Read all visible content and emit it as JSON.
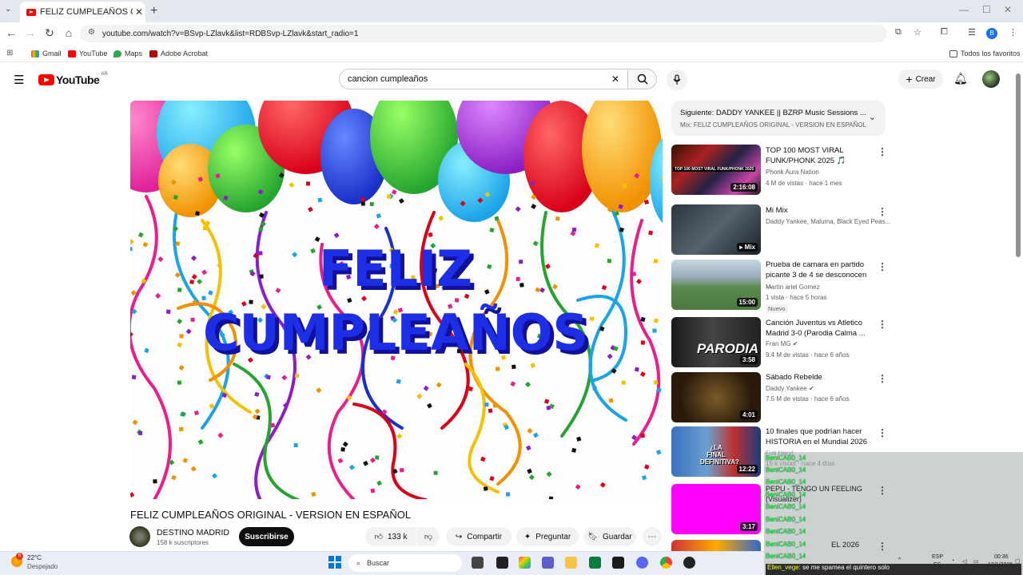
{
  "browser": {
    "tab_title": "FELIZ CUMPLEAÑOS ORIGINAL",
    "url": "youtube.com/watch?v=BSvp-LZlavk&list=RDBSvp-LZlavk&start_radio=1",
    "bookmarks": [
      "Gmail",
      "YouTube",
      "Maps",
      "Adobe Acrobat"
    ],
    "all_favorites": "Todos los favoritos",
    "profile_letter": "B"
  },
  "youtube": {
    "logo_text": "YouTube",
    "country": "AR",
    "search_value": "cancion cumpleaños",
    "create_label": "Crear"
  },
  "video": {
    "overlay_line1": "FELIZ",
    "overlay_line2": "CUMPLEAÑOS",
    "title": "FELIZ CUMPLEAÑOS ORIGINAL - VERSION EN ESPAÑOL",
    "channel": "DESTINO MADRID",
    "subscribers": "158 k suscriptores",
    "subscribe_label": "Suscribirse",
    "likes": "133 k",
    "share_label": "Compartir",
    "ask_label": "Preguntar",
    "save_label": "Guardar"
  },
  "up_next": {
    "line1": "Siguiente: DADDY YANKEE || BZRP Music Sessions ...",
    "line2": "Mix: FELIZ CUMPLEAÑOS ORIGINAL - VERSION EN ESPAÑOL"
  },
  "sidebar_videos": [
    {
      "title": "TOP 100 MOST VIRAL FUNK/PHONK 2025 🎵",
      "channel": "Phonk Aura Nation",
      "meta": "4 M de vistas · hace 1 mes",
      "duration": "2:16:08",
      "thumb_text": "TOP 100 MOST VIRAL FUNK/PHONK 2025"
    },
    {
      "title": "Mi Mix",
      "channel": "Daddy Yankee, Maluma, Black Eyed Peas...",
      "meta": "",
      "duration": "Mix"
    },
    {
      "title": "Prueba de camara en partido picante 3 de 4 se desconocen ...",
      "channel": "Martin ariel Gomez",
      "meta": "1 vista · hace 5 horas",
      "badge": "Nuevo",
      "duration": "15:00"
    },
    {
      "title": "Canción Juventus vs Atletico Madrid 3-0 (Parodia Calma ...",
      "channel": "Fran MG",
      "meta": "9.4 M de vistas · hace 6 años",
      "duration": "3:58",
      "thumb_text": "PARODIA"
    },
    {
      "title": "Sábado Rebelde",
      "channel": "Daddy Yankee",
      "meta": "7.5 M de vistas · hace 6 años",
      "duration": "4:01"
    },
    {
      "title": "10 finales que podrían hacer HISTORIA en el Mundial 2026",
      "channel": "Futi Hand",
      "meta": "15 k vistas · hace 4 días",
      "duration": "12:22",
      "thumb_text": "¿LA FINAL DEFINITIVA?"
    },
    {
      "title": "PEPU - TENGO UN FEELING (Visualizer)",
      "channel": "",
      "meta": "",
      "duration": "3:17"
    },
    {
      "title": "EL 2026",
      "channel": "",
      "meta": "",
      "duration": ""
    }
  ],
  "chat": {
    "user": "BeniCAB0_14",
    "last_user": "Ellen_vege",
    "last_message": "se me spamea el quintero solo"
  },
  "taskbar": {
    "temp": "22°C",
    "weather": "Despejado",
    "search_placeholder": "Buscar",
    "lang": "ESP",
    "lang2": "ES",
    "time": "00:36",
    "date": "12/1/2026",
    "notif_count": "6"
  }
}
